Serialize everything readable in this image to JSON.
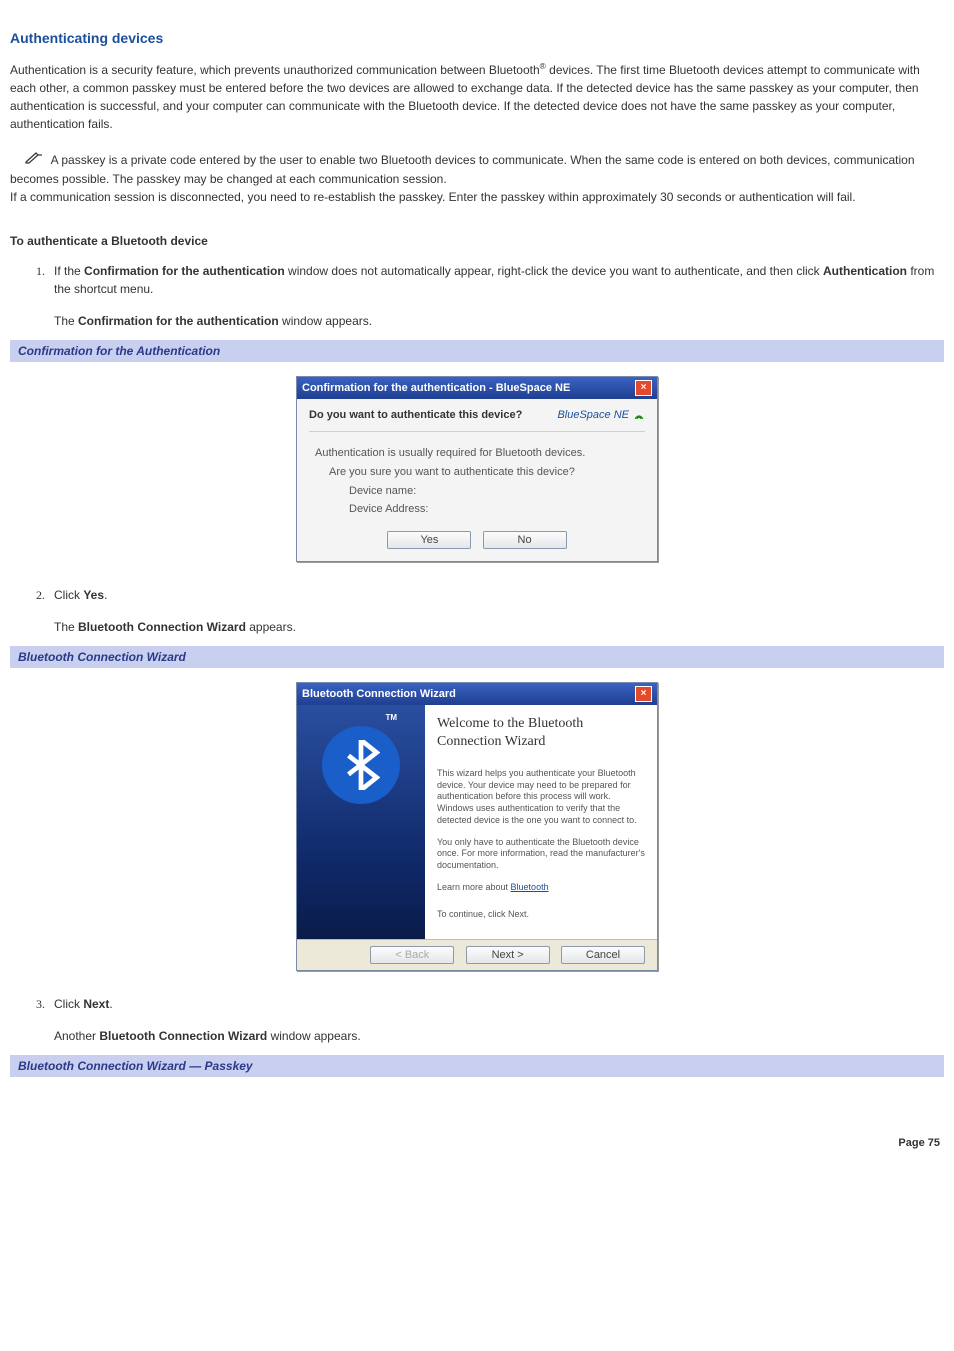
{
  "title": "Authenticating devices",
  "intro": "Authentication is a security feature, which prevents unauthorized communication between Bluetooth",
  "sup1": "®",
  "intro_cont": " devices. The first time Bluetooth devices attempt to communicate with each other, a common passkey must be entered before the two devices are allowed to exchange data. If the detected device has the same passkey as your computer, then authentication is successful, and your computer can communicate with the Bluetooth device. If the detected device does not have the same passkey as your computer, authentication fails.",
  "note_p1": " A passkey is a private code entered by the user to enable two Bluetooth devices to communicate. When the same code is entered on both devices, communication becomes possible. The passkey may be changed at each communication session.",
  "note_p2": "If a communication session is disconnected, you need to re-establish the passkey. Enter the passkey within approximately 30 seconds or authentication will fail.",
  "sub_heading": "To authenticate a Bluetooth device",
  "step1": {
    "pre": "If the ",
    "b1": "Confirmation for the authentication",
    "mid": " window does not automatically appear, right-click the device you want to authenticate, and then click ",
    "b2": "Authentication",
    "post": " from the shortcut menu.",
    "sub_pre": "The ",
    "sub_b": "Confirmation for the authentication",
    "sub_post": " window appears."
  },
  "caption1": "Confirmation for the Authentication",
  "conf_dialog": {
    "title": "Confirmation for the authentication - BlueSpace NE",
    "question": "Do you want to authenticate this device?",
    "brand": "BlueSpace NE",
    "line1": "Authentication is usually required for Bluetooth devices.",
    "line2": "Are you sure you want to authenticate this device?",
    "line3": "Device name:",
    "line4": "Device Address:",
    "yes": "Yes",
    "no": "No"
  },
  "step2": {
    "pre": "Click ",
    "b1": "Yes",
    "post": ".",
    "sub_pre": "The ",
    "sub_b": "Bluetooth Connection Wizard",
    "sub_post": " appears."
  },
  "caption2": "Bluetooth Connection Wizard",
  "wizard": {
    "title": "Bluetooth Connection Wizard",
    "tm": "TM",
    "welcome": "Welcome to the Bluetooth Connection Wizard",
    "p1": "This wizard helps you authenticate your Bluetooth device. Your device may need to be prepared for authentication before this process will work. Windows uses authentication to verify that the detected device is the one you want to connect to.",
    "p2": "You only have to authenticate the Bluetooth device once. For more information, read the manufacturer's documentation.",
    "learn_pre": "Learn more about ",
    "learn_link": "Bluetooth",
    "cont": "To continue, click Next.",
    "back": "< Back",
    "next": "Next >",
    "cancel": "Cancel"
  },
  "step3": {
    "pre": "Click ",
    "b1": "Next",
    "post": ".",
    "sub_pre": "Another ",
    "sub_b": "Bluetooth Connection Wizard",
    "sub_post": " window appears."
  },
  "caption3": "Bluetooth Connection Wizard — Passkey",
  "page_num": "Page 75"
}
